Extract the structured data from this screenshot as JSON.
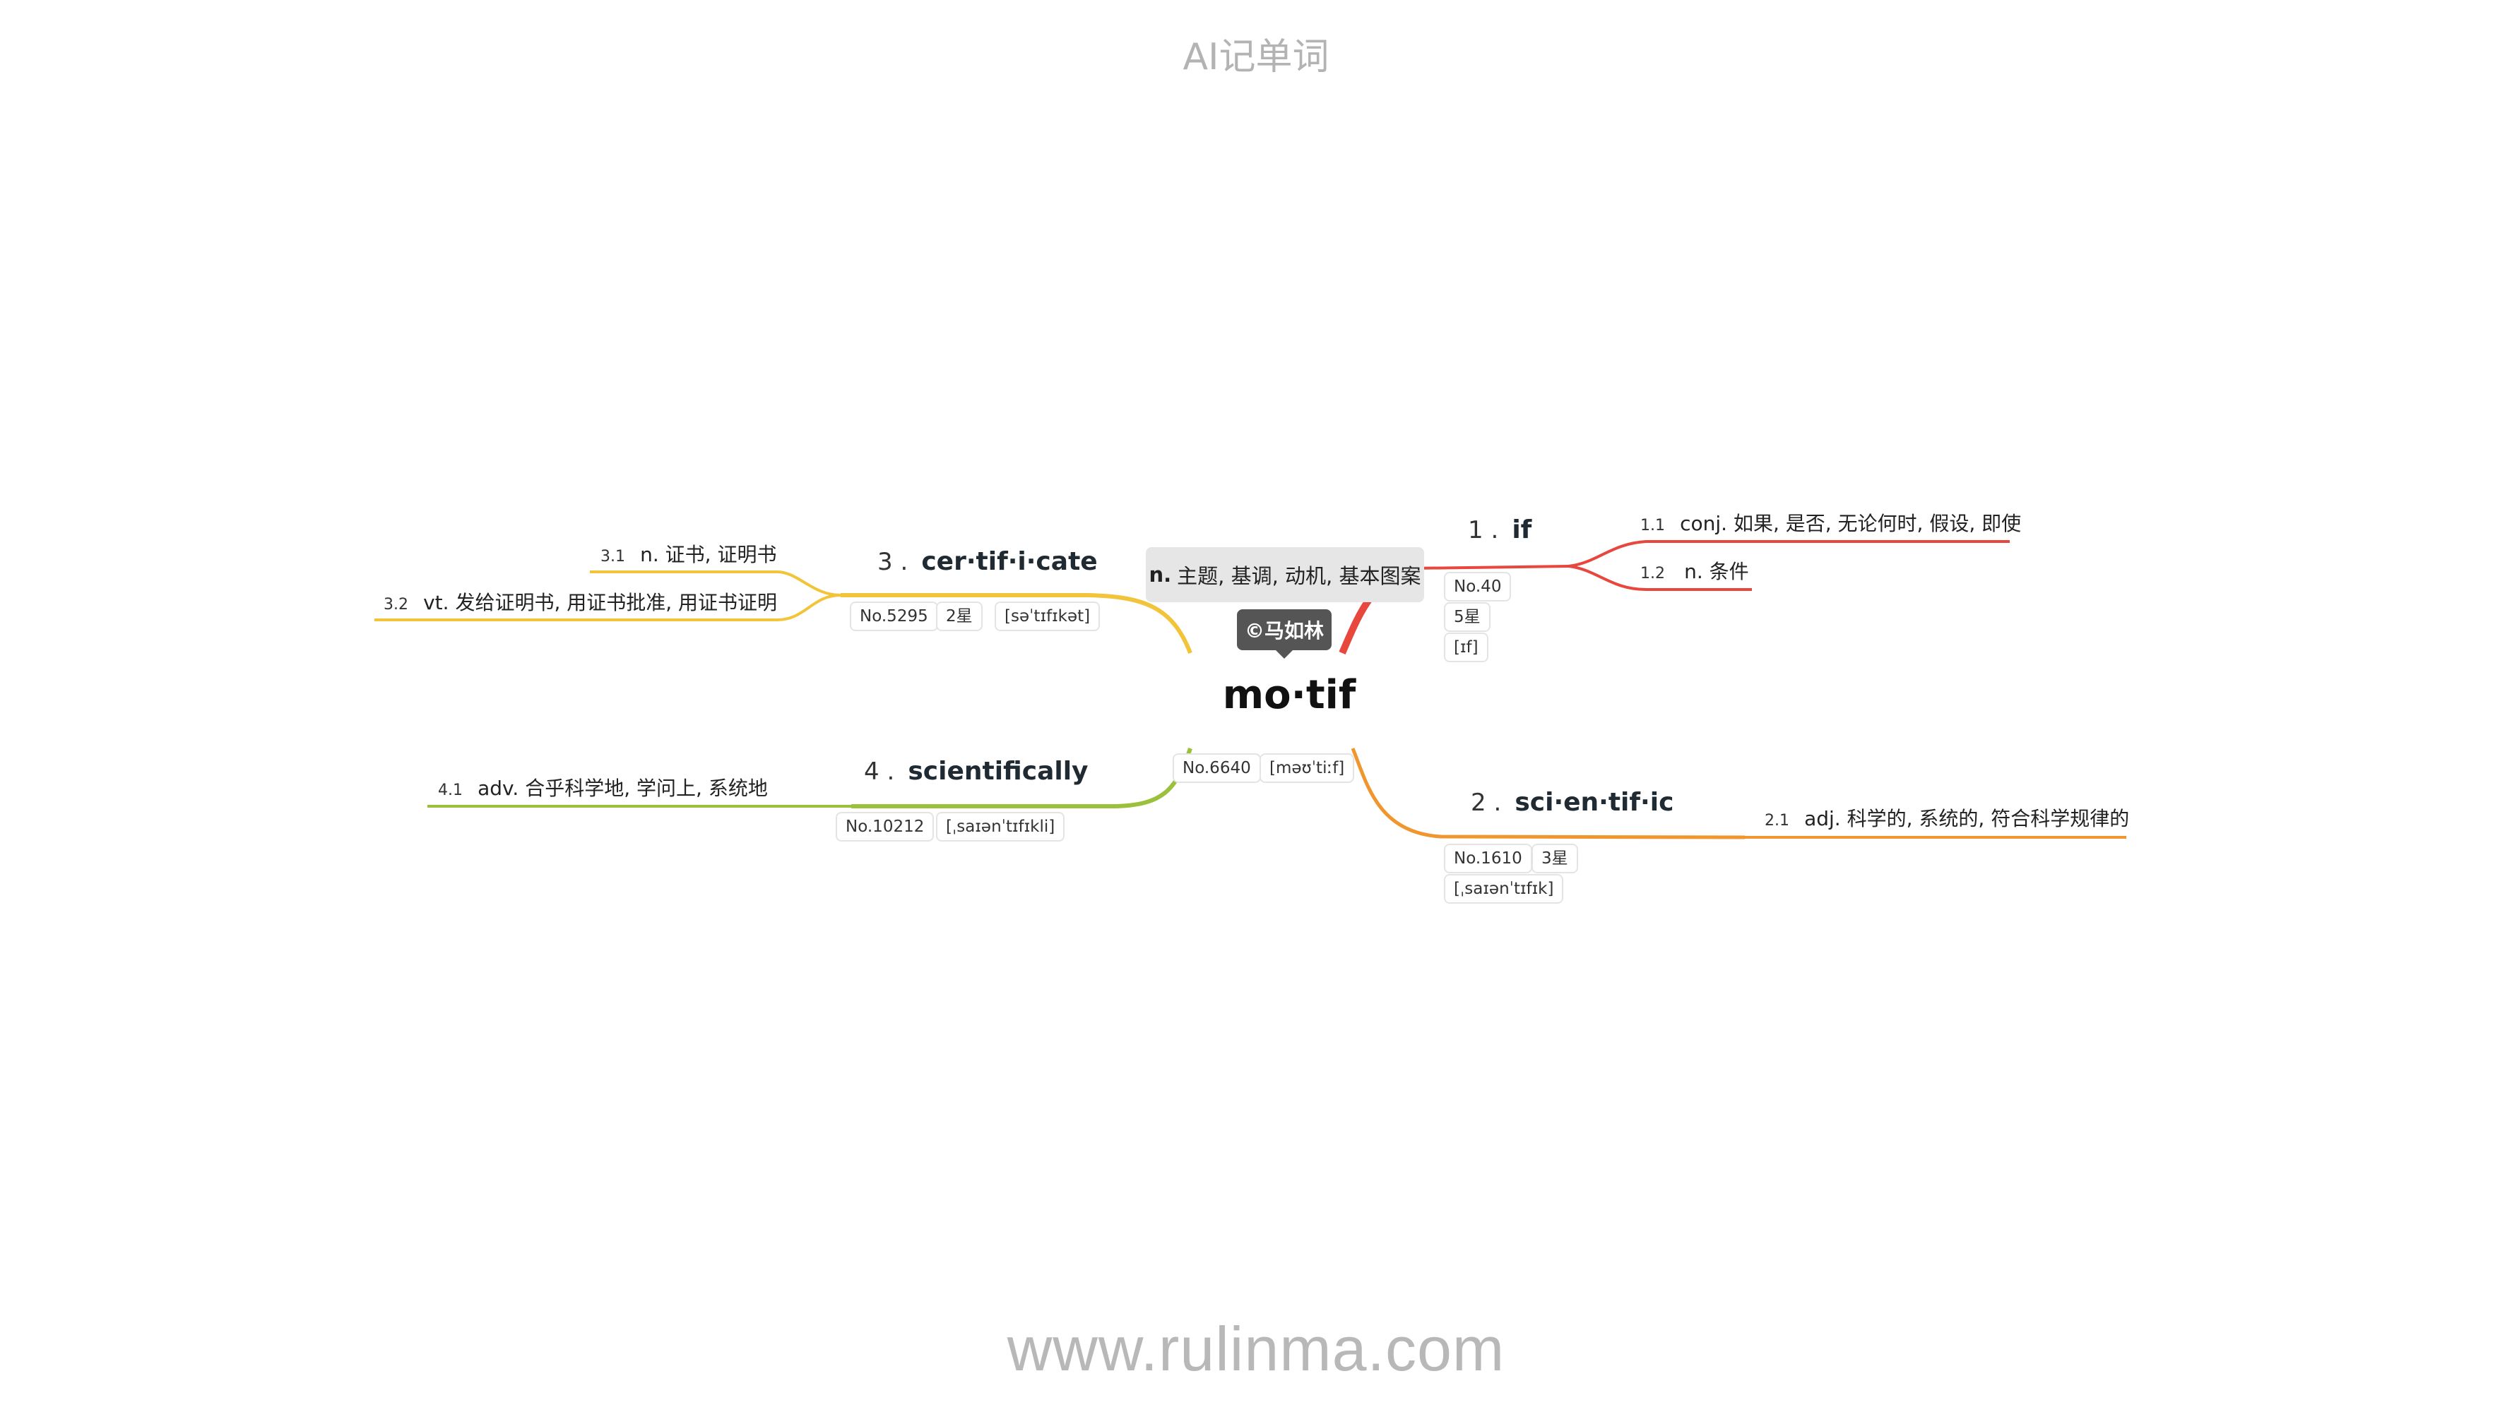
{
  "site": {
    "title": "AI记单词",
    "footer_url": "www.rulinma.com"
  },
  "center": {
    "word": "mo·tif",
    "definition_pos": "n.",
    "definition_text": "主题, 基调, 动机, 基本图案",
    "badge": "©马如林",
    "no": "No.6640",
    "phonetic": "[məʊˈtiːf]"
  },
  "branches": [
    {
      "num": "1 .",
      "word": "if",
      "color": "#e8473d",
      "chips": [
        "No.40",
        "5星",
        "[ɪf]"
      ],
      "senses": [
        {
          "num": "1.1",
          "text": "conj. 如果, 是否, 无论何时, 假设, 即使"
        },
        {
          "num": "1.2",
          "text": "n. 条件"
        }
      ]
    },
    {
      "num": "2 .",
      "word": "sci·en·tif·ic",
      "color": "#f0962e",
      "chips": [
        "No.1610",
        "3星",
        "[ˌsaɪənˈtɪfɪk]"
      ],
      "senses": [
        {
          "num": "2.1",
          "text": "adj. 科学的, 系统的, 符合科学规律的"
        }
      ]
    },
    {
      "num": "3 .",
      "word": "cer·tif·i·cate",
      "color": "#f2c43a",
      "chips": [
        "No.5295",
        "2星",
        "[səˈtɪfɪkət]"
      ],
      "senses": [
        {
          "num": "3.1",
          "text": "n. 证书, 证明书"
        },
        {
          "num": "3.2",
          "text": "vt. 发给证明书, 用证书批准, 用证书证明"
        }
      ]
    },
    {
      "num": "4 .",
      "word": "scientifically",
      "color": "#9bc13c",
      "chips": [
        "No.10212",
        "[ˌsaɪənˈtɪfɪkli]"
      ],
      "senses": [
        {
          "num": "4.1",
          "text": "adv. 合乎科学地, 学问上, 系统地"
        }
      ]
    }
  ]
}
